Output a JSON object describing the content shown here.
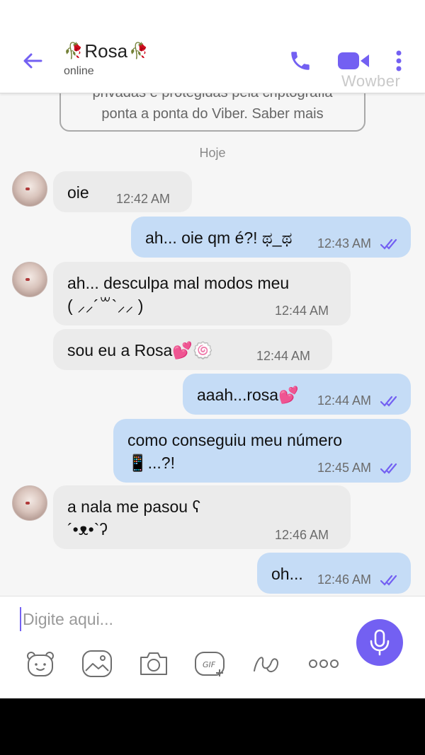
{
  "header": {
    "contact_name": "Rosa",
    "rose_left": "🥀",
    "rose_right": "🥀",
    "status": "online",
    "watermark": "Wowber"
  },
  "chat": {
    "encryption_line1": "privadas e protegidas pela criptografia",
    "encryption_line2": "ponta a ponta do Viber. Saber mais",
    "date_separator": "Hoje",
    "messages": [
      {
        "dir": "in",
        "line1": "oie",
        "line2": "",
        "time": "12:42 AM"
      },
      {
        "dir": "out",
        "line1": "ah... oie qm é?! ಥ_ಥ",
        "line2": "",
        "time": "12:43 AM"
      },
      {
        "dir": "in",
        "line1": "ah... desculpa mal modos meu",
        "line2": "( ⸝⸝´꒳`⸝⸝ )",
        "time": "12:44 AM"
      },
      {
        "dir": "in",
        "line1": "sou eu a Rosa💕🍥",
        "line2": "",
        "time": "12:44 AM"
      },
      {
        "dir": "out",
        "line1": "aaah...rosa💕",
        "line2": "",
        "time": "12:44 AM"
      },
      {
        "dir": "out",
        "line1": "como conseguiu meu número",
        "line2": "📱...?!",
        "time": "12:45 AM"
      },
      {
        "dir": "in",
        "line1": "a nala me pasou ʕ",
        "line2": "´•ᴥ•`ʔ",
        "time": "12:46 AM"
      },
      {
        "dir": "out",
        "line1": "oh...",
        "line2": "",
        "time": "12:46 AM"
      }
    ]
  },
  "composer": {
    "placeholder": "Digite aqui..."
  },
  "colors": {
    "accent": "#7360f2",
    "outgoing_bubble": "#c5dcf6",
    "incoming_bubble": "#ebebeb",
    "read_ticks": "#7360f2"
  },
  "icons": {
    "back": "arrow-left-icon",
    "call": "phone-icon",
    "video": "video-camera-icon",
    "more": "more-vertical-icon",
    "mic": "microphone-icon",
    "tools": [
      "sticker-icon",
      "gallery-icon",
      "camera-icon",
      "gif-icon",
      "doodle-icon",
      "more-horizontal-icon"
    ]
  }
}
